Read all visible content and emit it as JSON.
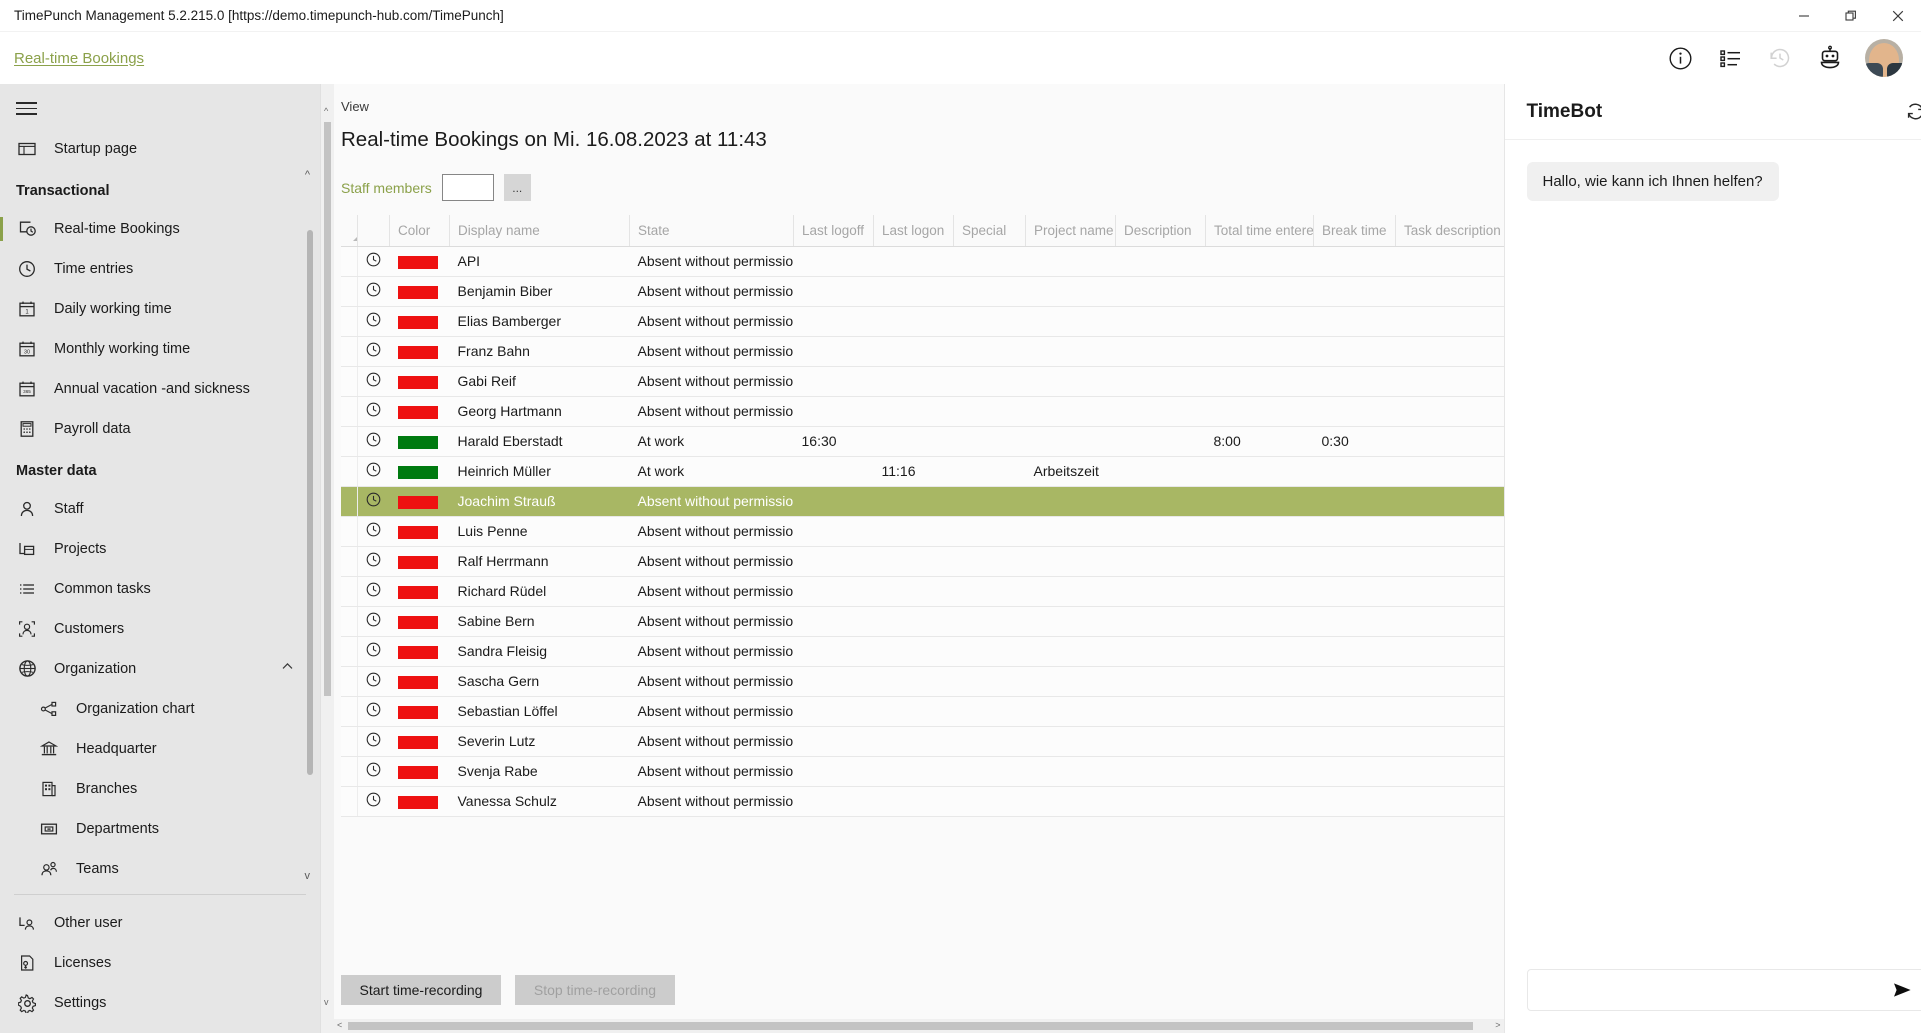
{
  "window": {
    "title": "TimePunch Management 5.2.215.0 [https://demo.timepunch-hub.com/TimePunch]",
    "minimize_label": "Minimize",
    "maximize_label": "Restore",
    "close_label": "Close"
  },
  "header": {
    "breadcrumb": "Real-time Bookings",
    "icons": [
      {
        "name": "info-icon",
        "label": "Information"
      },
      {
        "name": "list-icon",
        "label": "Task list"
      },
      {
        "name": "history-icon",
        "label": "History"
      },
      {
        "name": "bot-icon",
        "label": "TimeBot"
      }
    ],
    "avatar_label": "User profile"
  },
  "sidebar": {
    "menu_label": "Menu",
    "items": [
      {
        "label": "Startup page",
        "icon": "startup-page-icon",
        "type": "item"
      },
      {
        "label": "Transactional",
        "type": "group"
      },
      {
        "label": "Real-time Bookings",
        "icon": "realtime-bookings-icon",
        "type": "item",
        "active": true
      },
      {
        "label": "Time entries",
        "icon": "clock-icon",
        "type": "item"
      },
      {
        "label": "Daily working time",
        "icon": "calendar-day-icon",
        "type": "item"
      },
      {
        "label": "Monthly working time",
        "icon": "calendar-month-icon",
        "type": "item"
      },
      {
        "label": "Annual vacation -and sickness",
        "icon": "calendar-year-icon",
        "type": "item"
      },
      {
        "label": "Payroll data",
        "icon": "payroll-icon",
        "type": "item"
      },
      {
        "label": "Master data",
        "type": "group"
      },
      {
        "label": "Staff",
        "icon": "person-icon",
        "type": "item"
      },
      {
        "label": "Projects",
        "icon": "projects-icon",
        "type": "item"
      },
      {
        "label": "Common tasks",
        "icon": "tasks-icon",
        "type": "item"
      },
      {
        "label": "Customers",
        "icon": "customers-icon",
        "type": "item"
      },
      {
        "label": "Organization",
        "icon": "globe-icon",
        "type": "item",
        "expanded": true
      },
      {
        "label": "Organization chart",
        "icon": "org-chart-icon",
        "type": "sub"
      },
      {
        "label": "Headquarter",
        "icon": "headquarter-icon",
        "type": "sub"
      },
      {
        "label": "Branches",
        "icon": "branches-icon",
        "type": "sub"
      },
      {
        "label": "Departments",
        "icon": "departments-icon",
        "type": "sub"
      },
      {
        "label": "Teams",
        "icon": "teams-icon",
        "type": "sub"
      }
    ],
    "bottom_items": [
      {
        "label": "Other user",
        "icon": "other-user-icon"
      },
      {
        "label": "Licenses",
        "icon": "license-icon"
      },
      {
        "label": "Settings",
        "icon": "gear-icon"
      }
    ]
  },
  "main": {
    "view_label": "View",
    "page_title": "Real-time Bookings on Mi. 16.08.2023 at 11:43",
    "filter": {
      "label": "Staff members",
      "value": "",
      "placeholder": "",
      "more_button": "..."
    },
    "buttons": {
      "start": "Start time-recording",
      "stop": "Stop time-recording"
    }
  },
  "grid": {
    "columns": [
      "Color",
      "Display name",
      "State",
      "Last logoff",
      "Last logon",
      "Special",
      "Project name",
      "Description",
      "Total time entered",
      "Break time",
      "Task description"
    ],
    "rows": [
      {
        "color": "#ee1111",
        "display_name": "API",
        "state": "Absent without permission",
        "last_logoff": "",
        "last_logon": "",
        "special": "",
        "project_name": "",
        "description": "",
        "total_time_entered": "",
        "break_time": "",
        "task_description": "",
        "selected": false
      },
      {
        "color": "#ee1111",
        "display_name": "Benjamin Biber",
        "state": "Absent without permission",
        "last_logoff": "",
        "last_logon": "",
        "special": "",
        "project_name": "",
        "description": "",
        "total_time_entered": "",
        "break_time": "",
        "task_description": "",
        "selected": false
      },
      {
        "color": "#ee1111",
        "display_name": "Elias Bamberger",
        "state": "Absent without permission",
        "last_logoff": "",
        "last_logon": "",
        "special": "",
        "project_name": "",
        "description": "",
        "total_time_entered": "",
        "break_time": "",
        "task_description": "",
        "selected": false
      },
      {
        "color": "#ee1111",
        "display_name": "Franz Bahn",
        "state": "Absent without permission",
        "last_logoff": "",
        "last_logon": "",
        "special": "",
        "project_name": "",
        "description": "",
        "total_time_entered": "",
        "break_time": "",
        "task_description": "",
        "selected": false
      },
      {
        "color": "#ee1111",
        "display_name": "Gabi Reif",
        "state": "Absent without permission",
        "last_logoff": "",
        "last_logon": "",
        "special": "",
        "project_name": "",
        "description": "",
        "total_time_entered": "",
        "break_time": "",
        "task_description": "",
        "selected": false
      },
      {
        "color": "#ee1111",
        "display_name": "Georg Hartmann",
        "state": "Absent without permission",
        "last_logoff": "",
        "last_logon": "",
        "special": "",
        "project_name": "",
        "description": "",
        "total_time_entered": "",
        "break_time": "",
        "task_description": "",
        "selected": false
      },
      {
        "color": "#007a10",
        "display_name": "Harald Eberstadt",
        "state": "At work",
        "last_logoff": "16:30",
        "last_logon": "",
        "special": "",
        "project_name": "",
        "description": "",
        "total_time_entered": "8:00",
        "break_time": "0:30",
        "task_description": "",
        "selected": false
      },
      {
        "color": "#007a10",
        "display_name": "Heinrich  Müller",
        "state": "At work",
        "last_logoff": "",
        "last_logon": "11:16",
        "special": "",
        "project_name": "Arbeitszeit",
        "description": "",
        "total_time_entered": "",
        "break_time": "",
        "task_description": "",
        "selected": false
      },
      {
        "color": "#ee1111",
        "display_name": "Joachim Strauß",
        "state": "Absent without permission",
        "last_logoff": "",
        "last_logon": "",
        "special": "",
        "project_name": "",
        "description": "",
        "total_time_entered": "",
        "break_time": "",
        "task_description": "",
        "selected": true
      },
      {
        "color": "#ee1111",
        "display_name": "Luis Penne",
        "state": "Absent without permission",
        "last_logoff": "",
        "last_logon": "",
        "special": "",
        "project_name": "",
        "description": "",
        "total_time_entered": "",
        "break_time": "",
        "task_description": "",
        "selected": false
      },
      {
        "color": "#ee1111",
        "display_name": "Ralf Herrmann",
        "state": "Absent without permission",
        "last_logoff": "",
        "last_logon": "",
        "special": "",
        "project_name": "",
        "description": "",
        "total_time_entered": "",
        "break_time": "",
        "task_description": "",
        "selected": false
      },
      {
        "color": "#ee1111",
        "display_name": "Richard Rüdel",
        "state": "Absent without permission",
        "last_logoff": "",
        "last_logon": "",
        "special": "",
        "project_name": "",
        "description": "",
        "total_time_entered": "",
        "break_time": "",
        "task_description": "",
        "selected": false
      },
      {
        "color": "#ee1111",
        "display_name": "Sabine Bern",
        "state": "Absent without permission",
        "last_logoff": "",
        "last_logon": "",
        "special": "",
        "project_name": "",
        "description": "",
        "total_time_entered": "",
        "break_time": "",
        "task_description": "",
        "selected": false
      },
      {
        "color": "#ee1111",
        "display_name": "Sandra Fleisig",
        "state": "Absent without permission",
        "last_logoff": "",
        "last_logon": "",
        "special": "",
        "project_name": "",
        "description": "",
        "total_time_entered": "",
        "break_time": "",
        "task_description": "",
        "selected": false
      },
      {
        "color": "#ee1111",
        "display_name": "Sascha Gern",
        "state": "Absent without permission",
        "last_logoff": "",
        "last_logon": "",
        "special": "",
        "project_name": "",
        "description": "",
        "total_time_entered": "",
        "break_time": "",
        "task_description": "",
        "selected": false
      },
      {
        "color": "#ee1111",
        "display_name": "Sebastian Löffel",
        "state": "Absent without permission",
        "last_logoff": "",
        "last_logon": "",
        "special": "",
        "project_name": "",
        "description": "",
        "total_time_entered": "",
        "break_time": "",
        "task_description": "",
        "selected": false
      },
      {
        "color": "#ee1111",
        "display_name": "Severin Lutz",
        "state": "Absent without permission",
        "last_logoff": "",
        "last_logon": "",
        "special": "",
        "project_name": "",
        "description": "",
        "total_time_entered": "",
        "break_time": "",
        "task_description": "",
        "selected": false
      },
      {
        "color": "#ee1111",
        "display_name": "Svenja Rabe",
        "state": "Absent without permission",
        "last_logoff": "",
        "last_logon": "",
        "special": "",
        "project_name": "",
        "description": "",
        "total_time_entered": "",
        "break_time": "",
        "task_description": "",
        "selected": false
      },
      {
        "color": "#ee1111",
        "display_name": "Vanessa Schulz",
        "state": "Absent without permission",
        "last_logoff": "",
        "last_logon": "",
        "special": "",
        "project_name": "",
        "description": "",
        "total_time_entered": "",
        "break_time": "",
        "task_description": "",
        "selected": false
      }
    ]
  },
  "timebot": {
    "title": "TimeBot",
    "refresh_label": "Refresh",
    "messages": [
      {
        "from": "bot",
        "text": "Hallo, wie kann ich Ihnen helfen?"
      }
    ],
    "input": {
      "value": "",
      "placeholder": ""
    },
    "send_label": "Send"
  },
  "colors": {
    "accent": "#8ba14a",
    "selection": "#a8b764",
    "status_absent": "#ee1111",
    "status_at_work": "#007a10",
    "sidebar_bg": "#e6e6e6"
  }
}
